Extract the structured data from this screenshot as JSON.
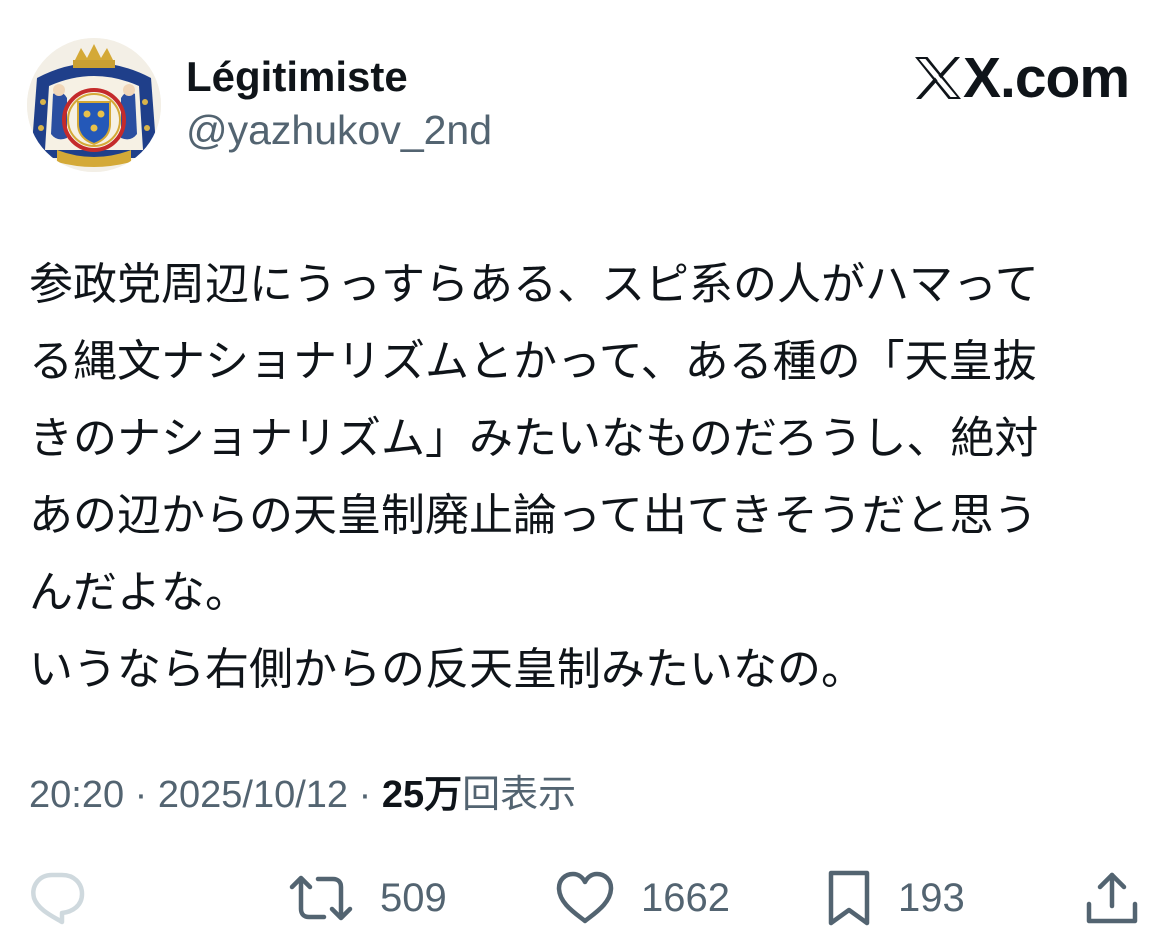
{
  "header": {
    "display_name": "Légitimiste",
    "handle": "@yazhukov_2nd",
    "avatar_icon": "coat-of-arms-avatar",
    "brand": "X.com"
  },
  "tweet": {
    "lines": [
      "参政党周辺にうっすらある、スピ系の人がハマって",
      "る縄文ナショナリズムとかって、ある種の「天皇抜",
      "きのナショナリズム」みたいなものだろうし、絶対",
      "あの辺からの天皇制廃止論って出てきそうだと思う",
      "んだよな。",
      "いうなら右側からの反天皇制みたいなの。"
    ]
  },
  "meta": {
    "time": "20:20",
    "separator": " · ",
    "date": "2025/10/12",
    "views_count": "25万",
    "views_label": "回表示"
  },
  "actions": {
    "reply": {
      "icon": "reply-icon",
      "count": ""
    },
    "repost": {
      "icon": "repost-icon",
      "count": "509"
    },
    "like": {
      "icon": "heart-icon",
      "count": "1662"
    },
    "bookmark": {
      "icon": "bookmark-icon",
      "count": "193"
    },
    "share": {
      "icon": "share-icon",
      "count": ""
    }
  },
  "colors": {
    "text": "#0f1419",
    "secondary": "#536471",
    "reply_icon": "#cfd9de",
    "background": "#ffffff"
  }
}
